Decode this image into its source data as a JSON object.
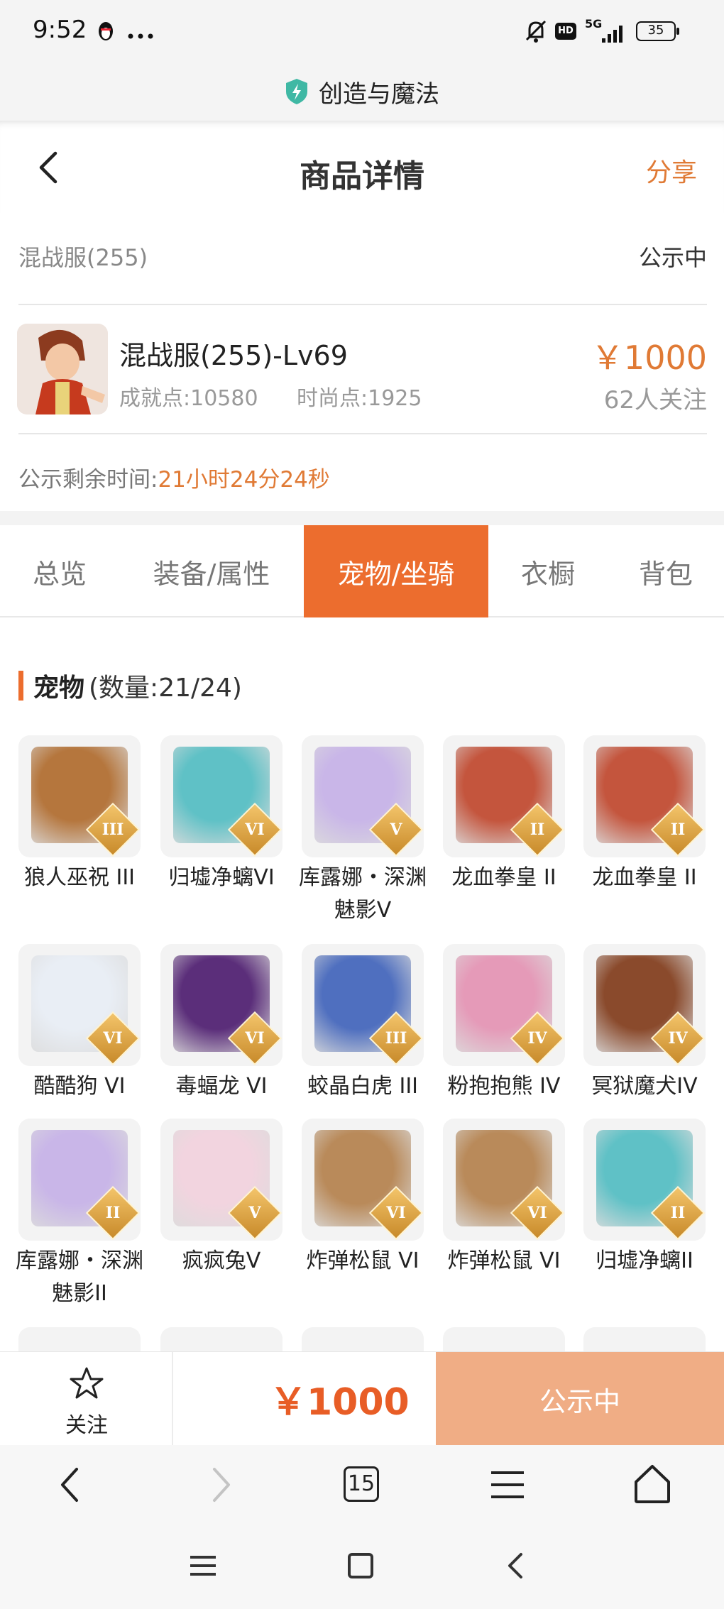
{
  "status_bar": {
    "time": "9:52",
    "network": "5G",
    "hd_badge": "HD",
    "battery": "35",
    "icons": [
      "qq-penguin-icon",
      "more-dots-icon",
      "bell-muted-icon",
      "signal-icon",
      "battery-icon"
    ]
  },
  "app": {
    "title": "创造与魔法",
    "shield_color": "#3fb8a4"
  },
  "nav": {
    "title": "商品详情",
    "share": "分享"
  },
  "listing": {
    "server": "混战服(255)",
    "status": "公示中",
    "character_name": "混战服(255)-Lv69",
    "achievement_points": "成就点:10580",
    "fashion_points": "时尚点:1925",
    "price": "￥1000",
    "followers": "62人关注",
    "remaining_label": "公示剩余时间:",
    "remaining_time": "21小时24分24秒"
  },
  "tabs": [
    {
      "label": "总览",
      "active": false
    },
    {
      "label": "装备/属性",
      "active": false
    },
    {
      "label": "宠物/坐骑",
      "active": true
    },
    {
      "label": "衣橱",
      "active": false
    },
    {
      "label": "背包",
      "active": false
    }
  ],
  "pets_section": {
    "title": "宠物",
    "count": "(数量:21/24)"
  },
  "pets": [
    {
      "name": "狼人巫祝 III",
      "rank": "III",
      "color": "#b5763d"
    },
    {
      "name": "归墟净螭VI",
      "rank": "VI",
      "color": "#5fc1c6"
    },
    {
      "name": "库露娜・深渊魅影V",
      "rank": "V",
      "color": "#c9b6e8"
    },
    {
      "name": "龙血拳皇 II",
      "rank": "II",
      "color": "#c4553d"
    },
    {
      "name": "龙血拳皇 II",
      "rank": "II",
      "color": "#c4553d"
    },
    {
      "name": "酷酷狗 VI",
      "rank": "VI",
      "color": "#e9eef5"
    },
    {
      "name": "毒蝠龙 VI",
      "rank": "VI",
      "color": "#5b2e7a"
    },
    {
      "name": "蛟晶白虎 III",
      "rank": "III",
      "color": "#4f6fbf"
    },
    {
      "name": "粉抱抱熊 IV",
      "rank": "IV",
      "color": "#e59ab8"
    },
    {
      "name": "冥狱魔犬IV",
      "rank": "IV",
      "color": "#8a4a2c"
    },
    {
      "name": "库露娜・深渊魅影II",
      "rank": "II",
      "color": "#c9b6e8"
    },
    {
      "name": "疯疯兔V",
      "rank": "V",
      "color": "#f2d4df"
    },
    {
      "name": "炸弹松鼠 VI",
      "rank": "VI",
      "color": "#b98a5a"
    },
    {
      "name": "炸弹松鼠 VI",
      "rank": "VI",
      "color": "#b98a5a"
    },
    {
      "name": "归墟净螭II",
      "rank": "II",
      "color": "#5fc1c6"
    }
  ],
  "bottom_bar": {
    "follow_label": "关注",
    "price": "￥1000",
    "status_button": "公示中"
  },
  "browser_bar": {
    "tab_count": "15"
  }
}
